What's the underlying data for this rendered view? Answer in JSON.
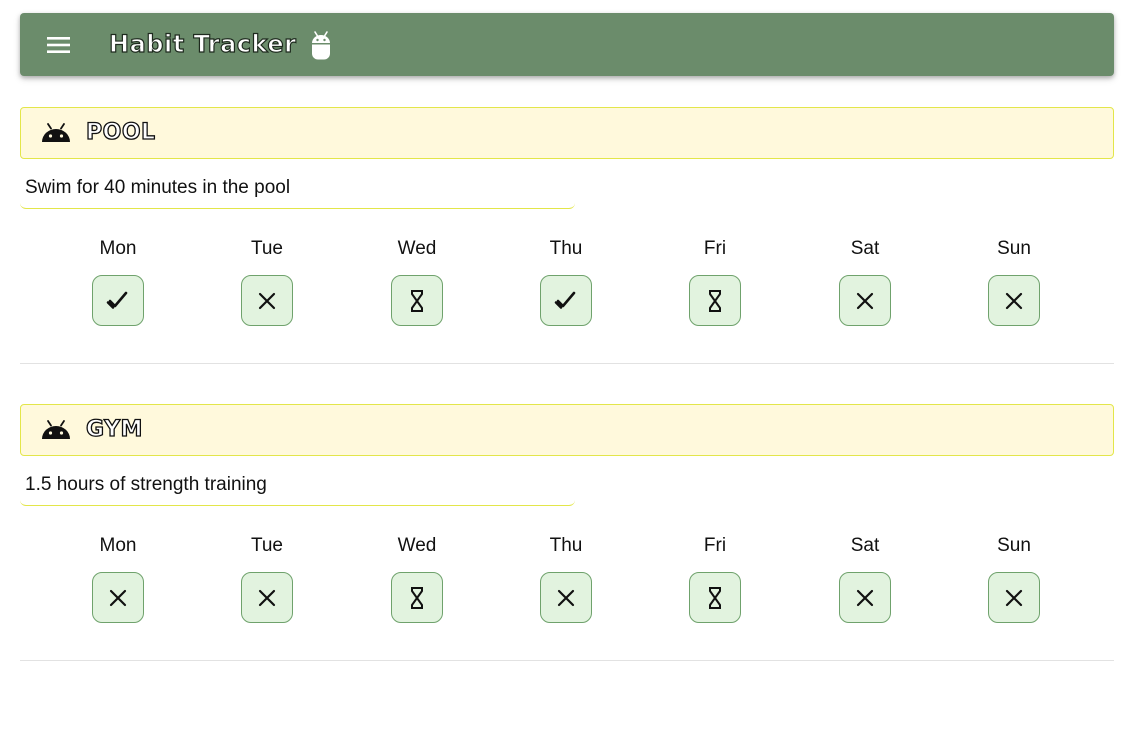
{
  "colors": {
    "brand": "#6b8c6b",
    "header_bg": "#fff9dc",
    "header_border": "#e3e64a",
    "btn_bg": "#e2f3df",
    "btn_border": "#6fa26c"
  },
  "appbar": {
    "title": "Habit Tracker",
    "menu_icon": "hamburger-menu-icon",
    "logo_icon": "android-robot-icon"
  },
  "habits": [
    {
      "name": "POOL",
      "icon": "android-head-icon",
      "description": "Swim for 40 minutes in the pool",
      "days": [
        {
          "label": "Mon",
          "status": "done"
        },
        {
          "label": "Tue",
          "status": "missed"
        },
        {
          "label": "Wed",
          "status": "pending"
        },
        {
          "label": "Thu",
          "status": "done"
        },
        {
          "label": "Fri",
          "status": "pending"
        },
        {
          "label": "Sat",
          "status": "missed"
        },
        {
          "label": "Sun",
          "status": "missed"
        }
      ]
    },
    {
      "name": "GYM",
      "icon": "android-head-icon",
      "description": "1.5 hours of strength training",
      "days": [
        {
          "label": "Mon",
          "status": "missed"
        },
        {
          "label": "Tue",
          "status": "missed"
        },
        {
          "label": "Wed",
          "status": "pending"
        },
        {
          "label": "Thu",
          "status": "missed"
        },
        {
          "label": "Fri",
          "status": "pending"
        },
        {
          "label": "Sat",
          "status": "missed"
        },
        {
          "label": "Sun",
          "status": "missed"
        }
      ]
    }
  ]
}
